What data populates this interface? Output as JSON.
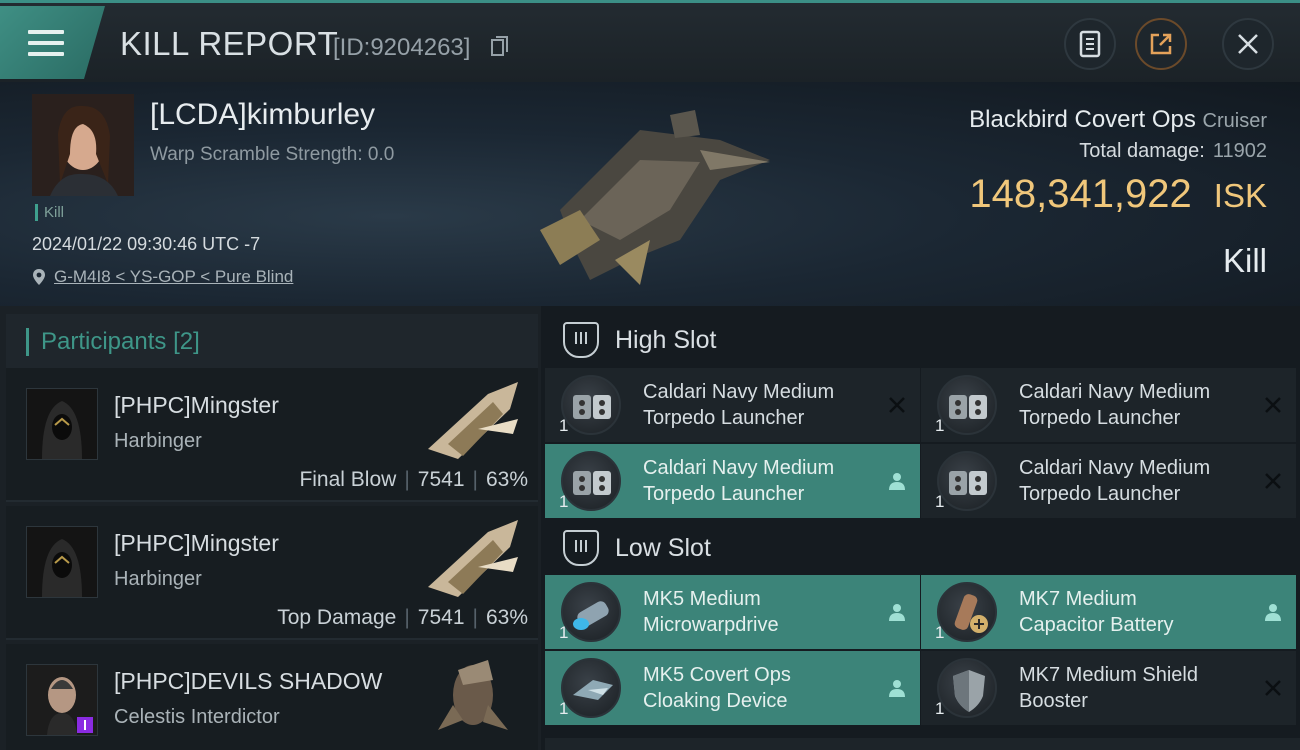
{
  "header": {
    "title": "KILL REPORT",
    "report_id": "[ID:9204263]",
    "icons": [
      "menu-icon",
      "copy-icon",
      "clipboard-icon",
      "share-icon",
      "close-icon"
    ]
  },
  "victim": {
    "name": "[LCDA]kimburley",
    "warp_scramble": "Warp Scramble Strength: 0.0",
    "tag": "Kill",
    "datetime": "2024/01/22 09:30:46 UTC -7",
    "location": "G-M4I8 < YS-GOP < Pure Blind",
    "ship": "Blackbird Covert Ops",
    "ship_class": "Cruiser",
    "total_damage_label": "Total damage:",
    "total_damage": "11902",
    "isk_value": "148,341,922",
    "isk_unit": "ISK",
    "result": "Kill"
  },
  "participants": {
    "label": "Participants",
    "count": "[2]",
    "items": [
      {
        "name": "[PHPC]Mingster",
        "ship": "Harbinger",
        "role": "Final Blow",
        "damage": "7541",
        "percent": "63%"
      },
      {
        "name": "[PHPC]Mingster",
        "ship": "Harbinger",
        "role": "Top Damage",
        "damage": "7541",
        "percent": "63%"
      },
      {
        "name": "[PHPC]DEVILS SHADOW",
        "ship": "Celestis Interdictor",
        "role": "",
        "damage": "",
        "percent": ""
      }
    ]
  },
  "fitting": {
    "high_slot": {
      "label": "High Slot",
      "items": [
        {
          "qty": "1",
          "line1": "Caldari Navy Medium",
          "line2": "Torpedo Launcher",
          "state": "destroyed"
        },
        {
          "qty": "1",
          "line1": "Caldari Navy Medium",
          "line2": "Torpedo Launcher",
          "state": "destroyed"
        },
        {
          "qty": "1",
          "line1": "Caldari Navy Medium",
          "line2": "Torpedo Launcher",
          "state": "dropped"
        },
        {
          "qty": "1",
          "line1": "Caldari Navy Medium",
          "line2": "Torpedo Launcher",
          "state": "destroyed"
        }
      ]
    },
    "low_slot": {
      "label": "Low Slot",
      "items": [
        {
          "qty": "1",
          "line1": "MK5 Medium",
          "line2": "Microwarpdrive",
          "state": "dropped"
        },
        {
          "qty": "1",
          "line1": "MK7 Medium",
          "line2": "Capacitor Battery",
          "state": "dropped"
        },
        {
          "qty": "1",
          "line1": "MK5 Covert Ops",
          "line2": "Cloaking Device",
          "state": "dropped"
        },
        {
          "qty": "1",
          "line1": "MK7 Medium Shield",
          "line2": "Booster",
          "state": "destroyed"
        }
      ]
    }
  }
}
